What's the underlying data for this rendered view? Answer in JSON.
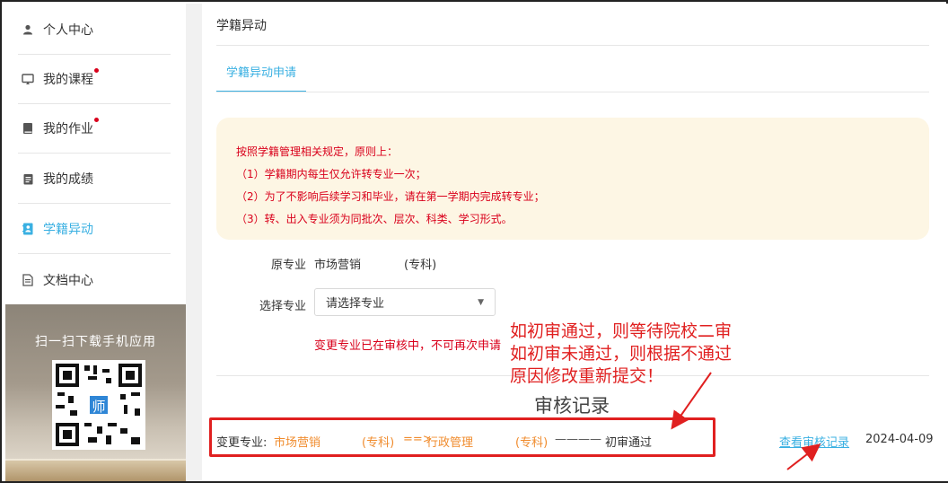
{
  "sidebar": {
    "items": [
      {
        "label": "个人中心",
        "icon": "user-icon",
        "dot": false
      },
      {
        "label": "我的课程",
        "icon": "monitor-icon",
        "dot": true
      },
      {
        "label": "我的作业",
        "icon": "book-icon",
        "dot": true
      },
      {
        "label": "我的成绩",
        "icon": "clipboard-icon",
        "dot": false
      },
      {
        "label": "学籍异动",
        "icon": "contact-card-icon",
        "dot": false,
        "active": true
      },
      {
        "label": "文档中心",
        "icon": "document-icon",
        "dot": false
      }
    ],
    "promo_text": "扫一扫下载手机应用",
    "qr_logo": "师"
  },
  "main": {
    "page_title": "学籍异动",
    "tab_label": "学籍异动申请",
    "notice": {
      "heading": "按照学籍管理相关规定，原则上：",
      "lines": [
        "（1）学籍期内每生仅允许转专业一次；",
        "（2）为了不影响后续学习和毕业，请在第一学期内完成转专业；",
        "（3）转、出入专业须为同批次、层次、科类、学习形式。"
      ]
    },
    "original_major": {
      "label": "原专业",
      "value": "市场营销",
      "level": "(专科)"
    },
    "select_major": {
      "label": "选择专业",
      "placeholder": "请选择专业"
    },
    "warning": "变更专业已在审核中，不可再次申请",
    "review": {
      "title": "审核记录",
      "prefix": "变更专业:",
      "from": "市场营销",
      "from_level": "(专科)",
      "arrow_text": "==>",
      "to": "行政管理",
      "to_level": "(专科)",
      "status_line": "————",
      "status": "初审通过",
      "link": "查看审核记录",
      "date": "2024-04-09"
    }
  },
  "annotation": {
    "lines": [
      "如初审通过，则等待院校二审",
      "如初审未通过，则根据不通过",
      "原因修改重新提交！"
    ]
  },
  "colors": {
    "accent": "#3ab0e2",
    "alert_red": "#d9001b",
    "annotation_red": "#e02020",
    "orange": "#f08c2e",
    "notice_bg": "#fdf6e4"
  }
}
